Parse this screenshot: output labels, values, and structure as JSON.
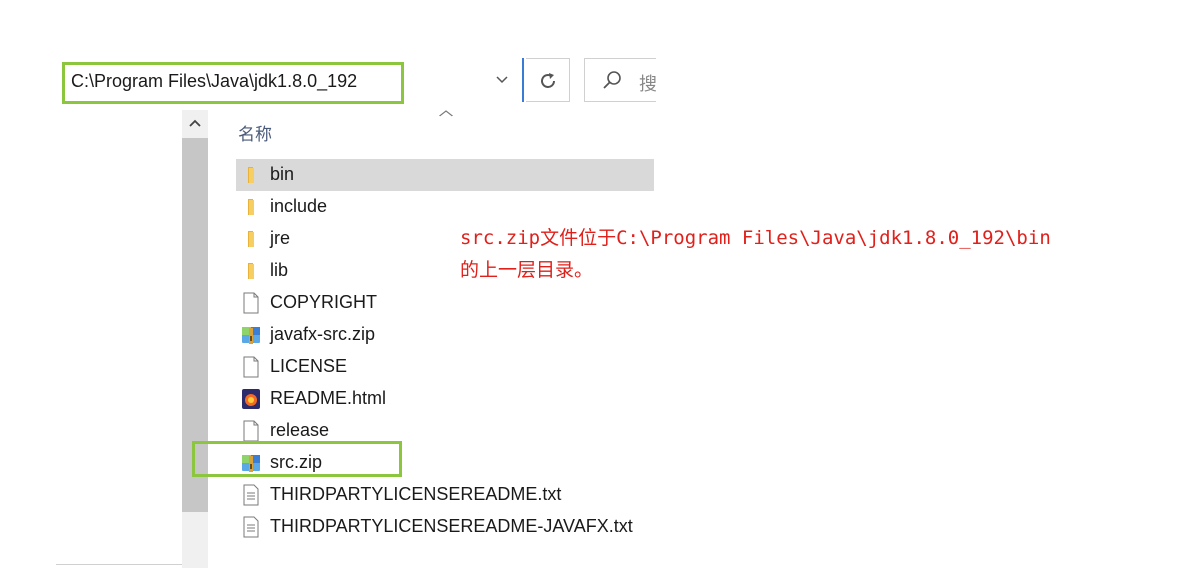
{
  "address_bar": {
    "path": "C:\\Program Files\\Java\\jdk1.8.0_192",
    "dropdown_icon": "chevron-down-icon",
    "refresh_icon": "refresh-icon"
  },
  "search": {
    "icon": "search-icon",
    "placeholder": "搜"
  },
  "columns": {
    "name_header": "名称"
  },
  "files": [
    {
      "name": "bin",
      "type": "folder",
      "selected": true
    },
    {
      "name": "include",
      "type": "folder"
    },
    {
      "name": "jre",
      "type": "folder"
    },
    {
      "name": "lib",
      "type": "folder"
    },
    {
      "name": "COPYRIGHT",
      "type": "file"
    },
    {
      "name": "javafx-src.zip",
      "type": "zip"
    },
    {
      "name": "LICENSE",
      "type": "file"
    },
    {
      "name": "README.html",
      "type": "html"
    },
    {
      "name": "release",
      "type": "file"
    },
    {
      "name": "src.zip",
      "type": "zip",
      "highlighted": true
    },
    {
      "name": "THIRDPARTYLICENSEREADME.txt",
      "type": "text"
    },
    {
      "name": "THIRDPARTYLICENSEREADME-JAVAFX.txt",
      "type": "text"
    }
  ],
  "annotation": {
    "line1": "src.zip文件位于C:\\Program Files\\Java\\jdk1.8.0_192\\bin",
    "line2": "的上一层目录。"
  },
  "colors": {
    "highlight": "#8cc63f",
    "annotation": "#e0201b",
    "selected_row": "#d9d9d9",
    "accent": "#3a7bd5"
  }
}
